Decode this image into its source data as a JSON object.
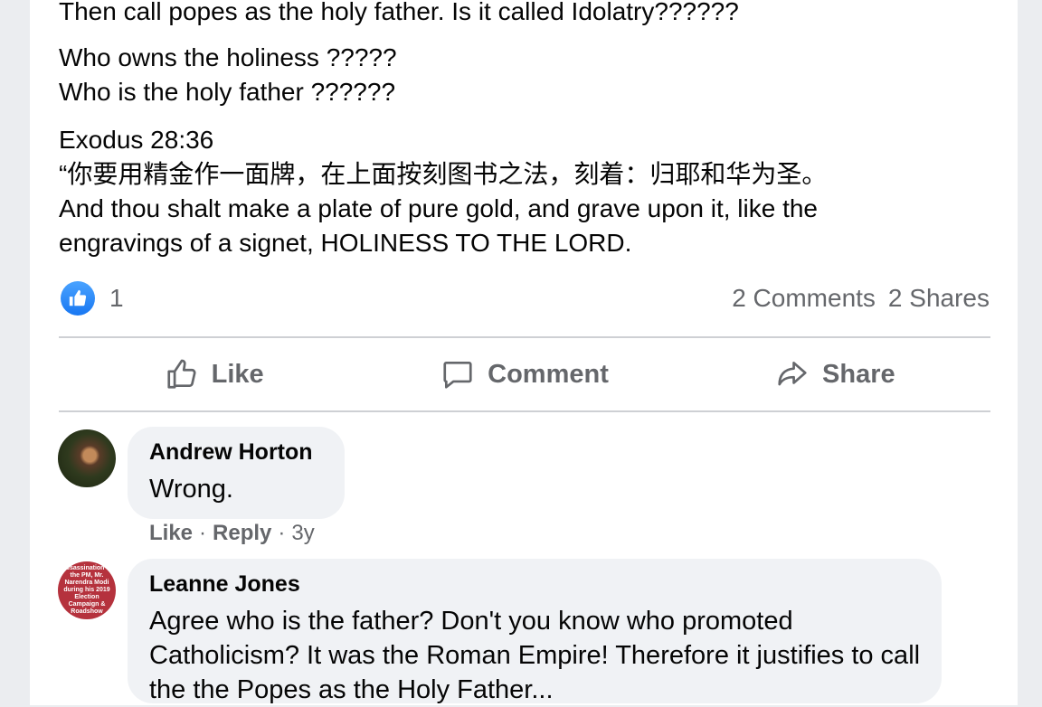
{
  "post": {
    "lines": [
      "Then call popes as the holy father. Is it called Idolatry??????",
      "Who owns the holiness ?????",
      "Who is the holy father ??????",
      "Exodus 28:36",
      "“你要用精金作一面牌，在上面按刻图书之法，刻着：归耶和华为圣。",
      "And thou shalt make a plate of pure gold, and grave upon it, like the",
      "engravings of a signet, HOLINESS TO THE LORD."
    ],
    "reaction_count": "1",
    "comments_count": "2 Comments",
    "shares_count": "2 Shares"
  },
  "actions": {
    "like": "Like",
    "comment": "Comment",
    "share": "Share"
  },
  "comments": [
    {
      "author": "Andrew Horton",
      "text": "Wrong.",
      "like": "Like",
      "reply": "Reply",
      "age": "3y"
    },
    {
      "author": "Leanne Jones",
      "text": "Agree who is the father? Don't you know who promoted Catholicism? It was the Roman Empire! Therefore it justifies to call the the Popes as the Holy Father...",
      "avatar_text": "Assassination of the PM, Mr. Narendra Modi during his 2019 Election Campaign & Roadshow"
    }
  ],
  "colors": {
    "accent": "#1877f2",
    "secondary_text": "#65676b",
    "bubble": "#f0f2f5"
  },
  "icons": {
    "reaction": "thumbs-up-icon",
    "like": "thumbs-up-outline-icon",
    "comment": "speech-bubble-icon",
    "share": "share-arrow-icon"
  }
}
